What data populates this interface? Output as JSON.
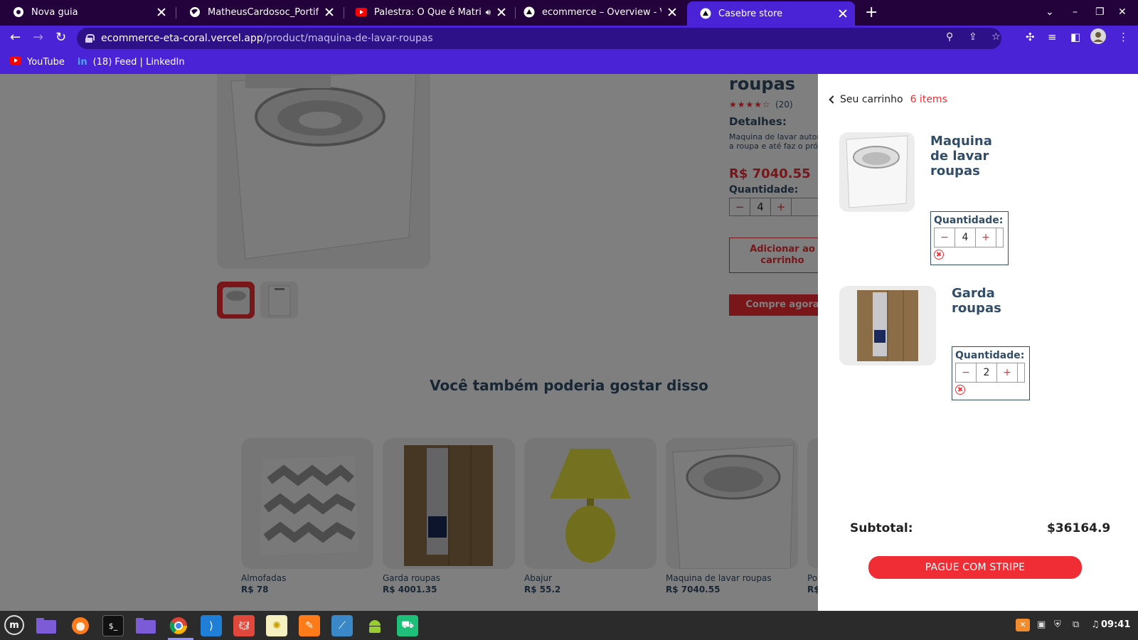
{
  "browser": {
    "tabs": [
      {
        "label": "Nova guia",
        "favicon": "chrome-icon"
      },
      {
        "label": "MatheusCardosoc_Portifolio",
        "favicon": "globe-icon"
      },
      {
        "label": "Palestra: O Que é Matrix?",
        "favicon": "youtube-icon"
      },
      {
        "label": "ecommerce – Overview - Verce",
        "favicon": "vercel-icon"
      },
      {
        "label": "Casebre store",
        "favicon": "vercel-icon"
      }
    ],
    "active_tab_index": 4,
    "url_host": "ecommerce-eta-coral.vercel.app",
    "url_path": "/product/maquina-de-lavar-roupas",
    "bookmarks": [
      {
        "label": "YouTube",
        "icon": "youtube-icon"
      },
      {
        "label": "(18) Feed | LinkedIn",
        "icon": "linkedin-icon"
      }
    ]
  },
  "product": {
    "title": "roupas",
    "stars": "★★★★☆",
    "reviews": "(20)",
    "details_heading": "Detalhes:",
    "details_text_1": "Maquina de lavar autom",
    "details_text_2": "a roupa e até faz o próp",
    "price": "R$ 7040.55",
    "quantity_label": "Quantidade:",
    "quantity": "4",
    "add_to_cart": "Adicionar ao carrinho",
    "buy_now": "Compre agora"
  },
  "may_like": {
    "heading": "Você também poderia gostar disso",
    "items": [
      {
        "name": "Almofadas",
        "price": "R$ 78"
      },
      {
        "name": "Garda roupas",
        "price": "R$ 4001.35"
      },
      {
        "name": "Abajur",
        "price": "R$ 55.2"
      },
      {
        "name": "Maquina de lavar roupas",
        "price": "R$ 7040.55"
      },
      {
        "name": "Pol",
        "price": "R$"
      }
    ]
  },
  "cart": {
    "heading": "Seu carrinho",
    "count": "6 items",
    "items": [
      {
        "name": "Maquina de lavar roupas",
        "quantity_label": "Quantidade:",
        "quantity": "4"
      },
      {
        "name": "Garda roupas",
        "quantity_label": "Quantidade:",
        "quantity": "2"
      }
    ],
    "subtotal_label": "Subtotal:",
    "subtotal_value": "$36164.9",
    "pay_button": "PAGUE COM STRIPE"
  },
  "taskbar": {
    "clock": "09:41"
  },
  "colors": {
    "accent": "#f02d34",
    "text_dark": "#324d67",
    "browser_purple": "#4a23d6"
  }
}
